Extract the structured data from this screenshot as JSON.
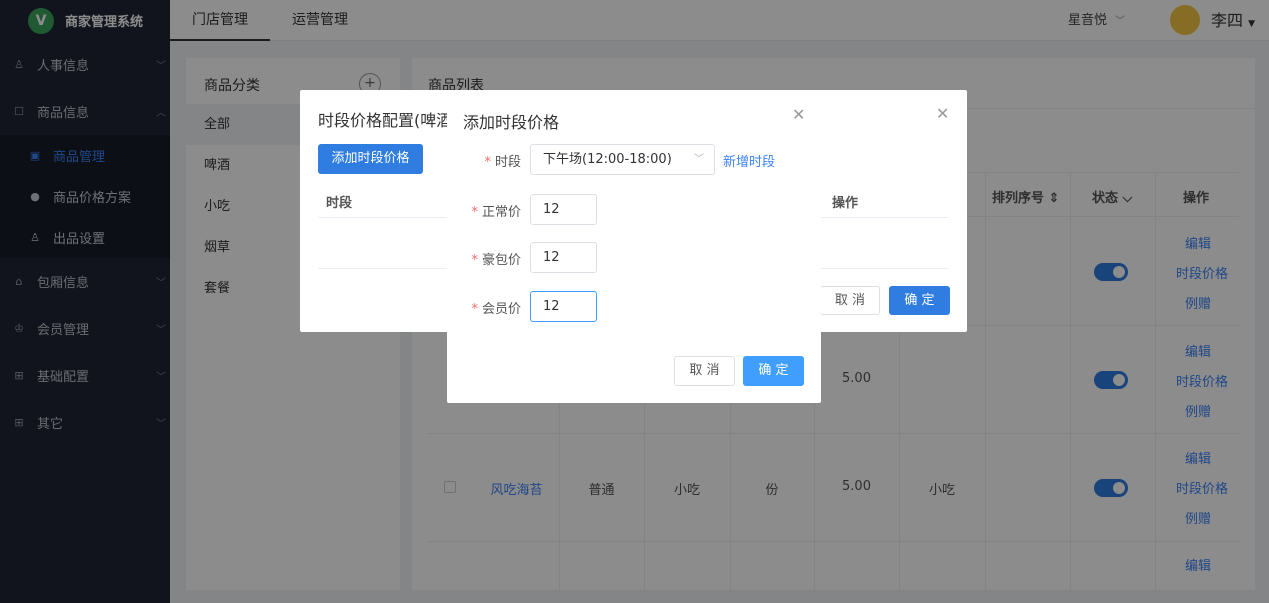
{
  "app": {
    "logo_letter": "V",
    "title": "商家管理系统"
  },
  "topnav": {
    "tabs": [
      {
        "label": "门店管理"
      },
      {
        "label": "运营管理"
      }
    ],
    "store": "星音悦",
    "user": "李四"
  },
  "sidebar": {
    "items": [
      {
        "label": "人事信息",
        "icon": "person-icon"
      },
      {
        "label": "商品信息",
        "icon": "goods-icon"
      },
      {
        "label": "包厢信息",
        "icon": "home-icon"
      },
      {
        "label": "会员管理",
        "icon": "crown-icon"
      },
      {
        "label": "基础配置",
        "icon": "grid-icon"
      },
      {
        "label": "其它",
        "icon": "grid-icon"
      }
    ],
    "subitems": [
      {
        "label": "商品管理",
        "icon": "goods-manage-icon",
        "active": true
      },
      {
        "label": "商品价格方案",
        "icon": "money-bag-icon"
      },
      {
        "label": "出品设置",
        "icon": "person-icon"
      }
    ]
  },
  "category": {
    "title": "商品分类",
    "items": [
      "全部",
      "啤酒",
      "小吃",
      "烟草",
      "套餐"
    ]
  },
  "list": {
    "title": "商品列表",
    "headers": {
      "sort": "排列序号 ⇕",
      "status": "状态 ⌵",
      "ops": "操作"
    },
    "rows": [
      {
        "name": "",
        "price": "5.00",
        "category": ""
      },
      {
        "name": "风吃海苔",
        "type": "普通",
        "group": "小吃",
        "unit": "份",
        "price": "5.00",
        "category": "小吃"
      }
    ],
    "actions": {
      "edit": "编辑",
      "time_price": "时段价格",
      "gift": "例赠"
    }
  },
  "dialog1": {
    "title": "时段价格配置(啤酒/",
    "add_button": "添加时段价格",
    "col_time": "时段",
    "col_ops": "操作",
    "cancel": "取 消",
    "confirm": "确 定"
  },
  "dialog2": {
    "title": "添加时段价格",
    "fields": {
      "period": {
        "label": "时段",
        "value": "下午场(12:00-18:00)"
      },
      "normal": {
        "label": "正常价",
        "value": "12"
      },
      "luxury": {
        "label": "豪包价",
        "value": "12"
      },
      "member": {
        "label": "会员价",
        "value": "12"
      }
    },
    "new_period": "新增时段",
    "cancel": "取 消",
    "confirm": "确 定"
  }
}
